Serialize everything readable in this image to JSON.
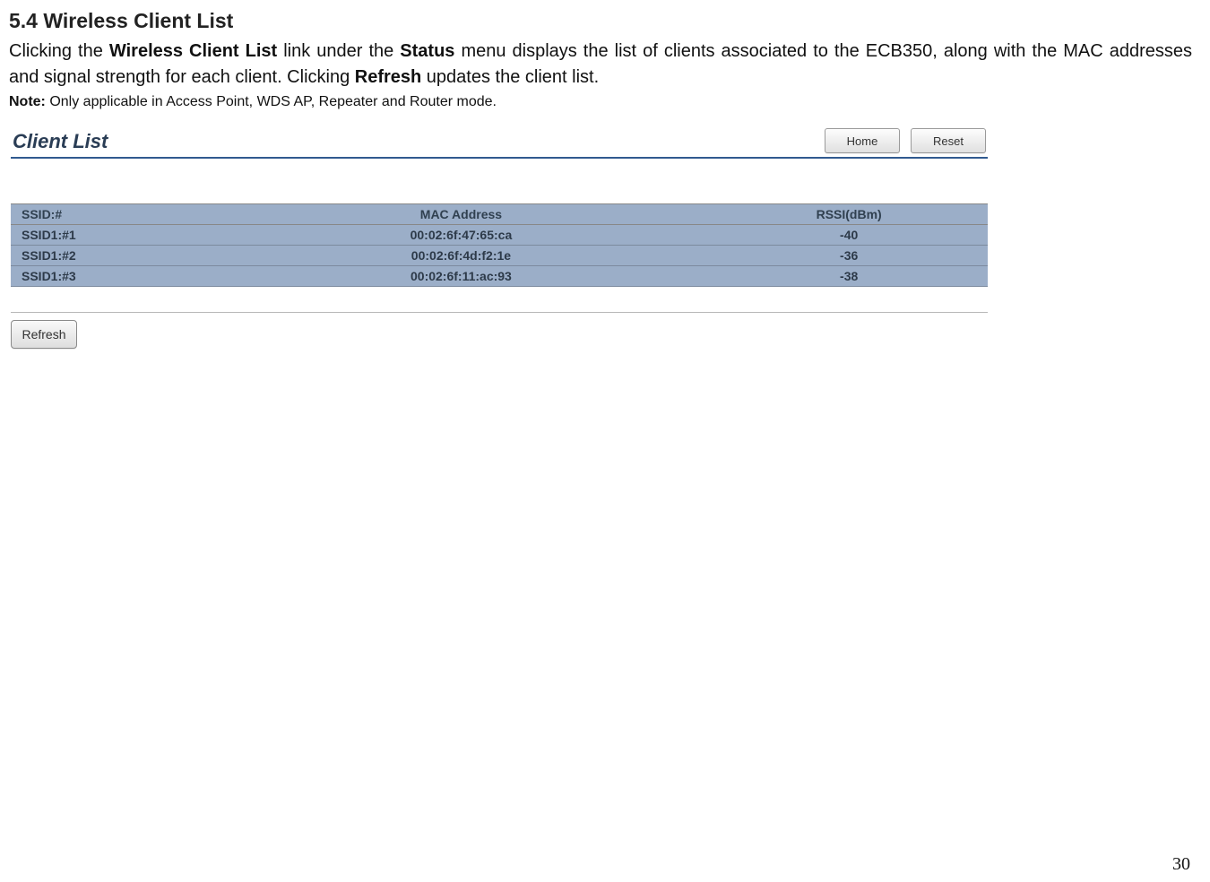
{
  "doc": {
    "section_title": "5.4   Wireless Client List",
    "p1_a": "Clicking the ",
    "p1_b1": "Wireless Client List",
    "p1_c": " link under the ",
    "p1_b2": "Status",
    "p1_d": " menu displays the list of clients associated to the ECB350, along with the MAC addresses and signal strength for each client. Clicking ",
    "p1_b3": "Refresh",
    "p1_e": " updates the client list.",
    "note_label": "Note:",
    "note_text": " Only applicable in Access Point, WDS AP, Repeater and Router mode.",
    "page_number": "30"
  },
  "panel": {
    "title": "Client List",
    "home_label": "Home",
    "reset_label": "Reset",
    "refresh_label": "Refresh",
    "headers": {
      "ssid": "SSID:#",
      "mac": "MAC Address",
      "rssi": "RSSI(dBm)"
    },
    "rows": [
      {
        "ssid": "SSID1:#1",
        "mac": "00:02:6f:47:65:ca",
        "rssi": "-40"
      },
      {
        "ssid": "SSID1:#2",
        "mac": "00:02:6f:4d:f2:1e",
        "rssi": "-36"
      },
      {
        "ssid": "SSID1:#3",
        "mac": "00:02:6f:11:ac:93",
        "rssi": "-38"
      }
    ]
  }
}
